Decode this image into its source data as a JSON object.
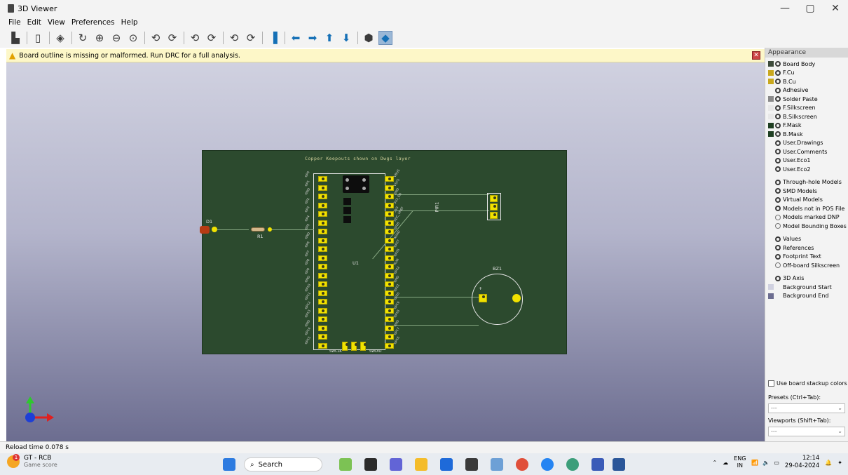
{
  "window": {
    "title": "3D Viewer",
    "minimize": "—",
    "restore": "▢",
    "close": "✕"
  },
  "menu": [
    "File",
    "Edit",
    "View",
    "Preferences",
    "Help"
  ],
  "warning": {
    "message": "Board outline is missing or malformed. Run DRC for a full analysis."
  },
  "board": {
    "keepout_text": "Copper Keepouts shown on Dwgs layer",
    "refs": {
      "d1": "D1",
      "r1": "R1",
      "u1": "U1",
      "pir1": "PIR1",
      "bz1": "BZ1",
      "swclk": "SWCLK",
      "swdio": "SWDIO",
      "plus": "+"
    },
    "left_pins": [
      "GP0",
      "GP1",
      "GND",
      "GP2",
      "GP3",
      "GP4",
      "GP5",
      "GND",
      "GP6",
      "GP7",
      "GP8",
      "GP9",
      "GND",
      "GP10",
      "GP11",
      "GP12",
      "GP13",
      "GND",
      "GP14",
      "GP15"
    ],
    "right_pins": [
      "VBUS",
      "VSYS",
      "GND",
      "3V3_EN",
      "3V3",
      "ADC_VREF",
      "GP28",
      "AGND",
      "GP27",
      "GP26",
      "RUN",
      "GP22",
      "GND",
      "GP21",
      "GP20",
      "GP19",
      "GP18",
      "GND",
      "GP17",
      "GP16"
    ]
  },
  "appearance": {
    "header": "Appearance",
    "layers": [
      {
        "name": "Board Body",
        "color": "#3d4a3a"
      },
      {
        "name": "F.Cu",
        "color": "#c9a81d"
      },
      {
        "name": "B.Cu",
        "color": "#c9a81d"
      },
      {
        "name": "Adhesive",
        "color": ""
      },
      {
        "name": "Solder Paste",
        "color": "#8a8a8a"
      },
      {
        "name": "F.Silkscreen",
        "color": "#e8e8e8"
      },
      {
        "name": "B.Silkscreen",
        "color": "#e8e8e8"
      },
      {
        "name": "F.Mask",
        "color": "#1f3f22"
      },
      {
        "name": "B.Mask",
        "color": "#1f3f22"
      },
      {
        "name": "User.Drawings",
        "color": ""
      },
      {
        "name": "User.Comments",
        "color": ""
      },
      {
        "name": "User.Eco1",
        "color": ""
      },
      {
        "name": "User.Eco2",
        "color": ""
      }
    ],
    "objects": [
      {
        "name": "Through-hole Models",
        "visible": true
      },
      {
        "name": "SMD Models",
        "visible": true
      },
      {
        "name": "Virtual Models",
        "visible": true
      },
      {
        "name": "Models not in POS File",
        "visible": true
      },
      {
        "name": "Models marked DNP",
        "visible": false
      },
      {
        "name": "Model Bounding Boxes",
        "visible": false
      }
    ],
    "text_items": [
      {
        "name": "Values",
        "visible": true
      },
      {
        "name": "References",
        "visible": true
      },
      {
        "name": "Footprint Text",
        "visible": true
      },
      {
        "name": "Off-board Silkscreen",
        "visible": false
      }
    ],
    "axis": "3D Axis",
    "background_start": "Background Start",
    "background_end": "Background End",
    "bg_start_color": "#d0d1e0",
    "bg_end_color": "#6c6d90",
    "use_stackup": "Use board stackup colors",
    "presets_label": "Presets (Ctrl+Tab):",
    "presets_value": "---",
    "viewports_label": "Viewports (Shift+Tab):",
    "viewports_value": "---"
  },
  "status": {
    "text": "Reload time 0.078 s"
  },
  "taskbar": {
    "weather_title": "GT - RCB",
    "weather_sub": "Game score",
    "search": "Search",
    "lang1": "ENG",
    "lang2": "IN",
    "time": "12:14",
    "date": "29-04-2024"
  }
}
